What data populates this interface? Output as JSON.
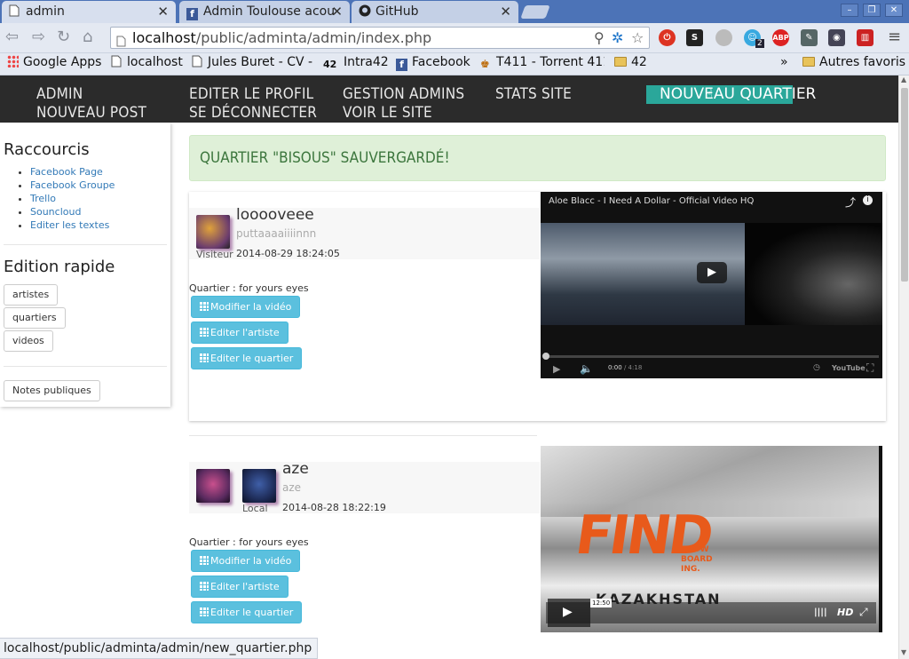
{
  "browser": {
    "tabs": [
      {
        "title": "admin",
        "active": true
      },
      {
        "title": "Admin Toulouse acou",
        "active": false
      },
      {
        "title": "GitHub",
        "active": false
      }
    ],
    "url_host": "localhost",
    "url_path": "/public/adminta/admin/index.php",
    "bookmarks": [
      "Google Apps",
      "localhost",
      "Jules Buret - CV - S",
      "Intra42",
      "Facebook",
      "T411 - Torrent 411",
      "42",
      "Autres favoris"
    ],
    "bookmarks_overflow": "»",
    "extension_badge": "2",
    "status_url": "localhost/public/adminta/admin/new_quartier.php"
  },
  "nav": {
    "admin": "ADMIN",
    "new_post": "NOUVEAU POST",
    "edit_profile": "EDITER LE PROFIL",
    "logout": "SE DÉCONNECTER",
    "manage_admins": "GESTION ADMINS",
    "view_site": "VOIR LE SITE",
    "stats": "STATS SITE",
    "new_quartier": "NOUVEAU QUARTIER"
  },
  "sidebar": {
    "shortcuts_title": "Raccourcis",
    "shortcuts": [
      "Facebook Page",
      "Facebook Groupe",
      "Trello",
      "Souncloud",
      "Editer les textes"
    ],
    "quick_edit_title": "Edition rapide",
    "quick_buttons": [
      "artistes",
      "quartiers",
      "videos"
    ],
    "notes_button": "Notes publiques"
  },
  "alert": "QUARTIER \"BISOUS\" SAUVERGARDÉ!",
  "posts": [
    {
      "title": "looooveee",
      "subtitle": "puttaaaaiiiinnn",
      "date": "2014-08-29 18:24:05",
      "role": "Visiteur",
      "quartier": "Quartier : for yours eyes",
      "buttons": [
        "Modifier la vidéo",
        "Editer l'artiste",
        "Editer le quartier"
      ],
      "video_title": "Aloe Blacc - I Need A Dollar - Official Video HQ",
      "video_time": "0:00",
      "video_duration": "4:18"
    },
    {
      "title": "aze",
      "subtitle": "aze",
      "date": "2014-08-28 18:22:19",
      "role": "Local",
      "quartier": "Quartier : for yours eyes",
      "buttons": [
        "Modifier la vidéo",
        "Editer l'artiste",
        "Editer le quartier"
      ],
      "video_overlay_title": "FIND",
      "video_overlay_sub": "SNOW BOARD ING.",
      "video_overlay_place": "KAZAKHSTAN",
      "video_hover_time": "12:50",
      "video_quality": "HD"
    }
  ],
  "colors": {
    "nav_bg": "#2b2b2b",
    "nav_button": "#2aa79a",
    "info_button": "#5bc0de",
    "alert_bg": "#dff0d8",
    "alert_text": "#3c763d",
    "link": "#337ab7"
  }
}
